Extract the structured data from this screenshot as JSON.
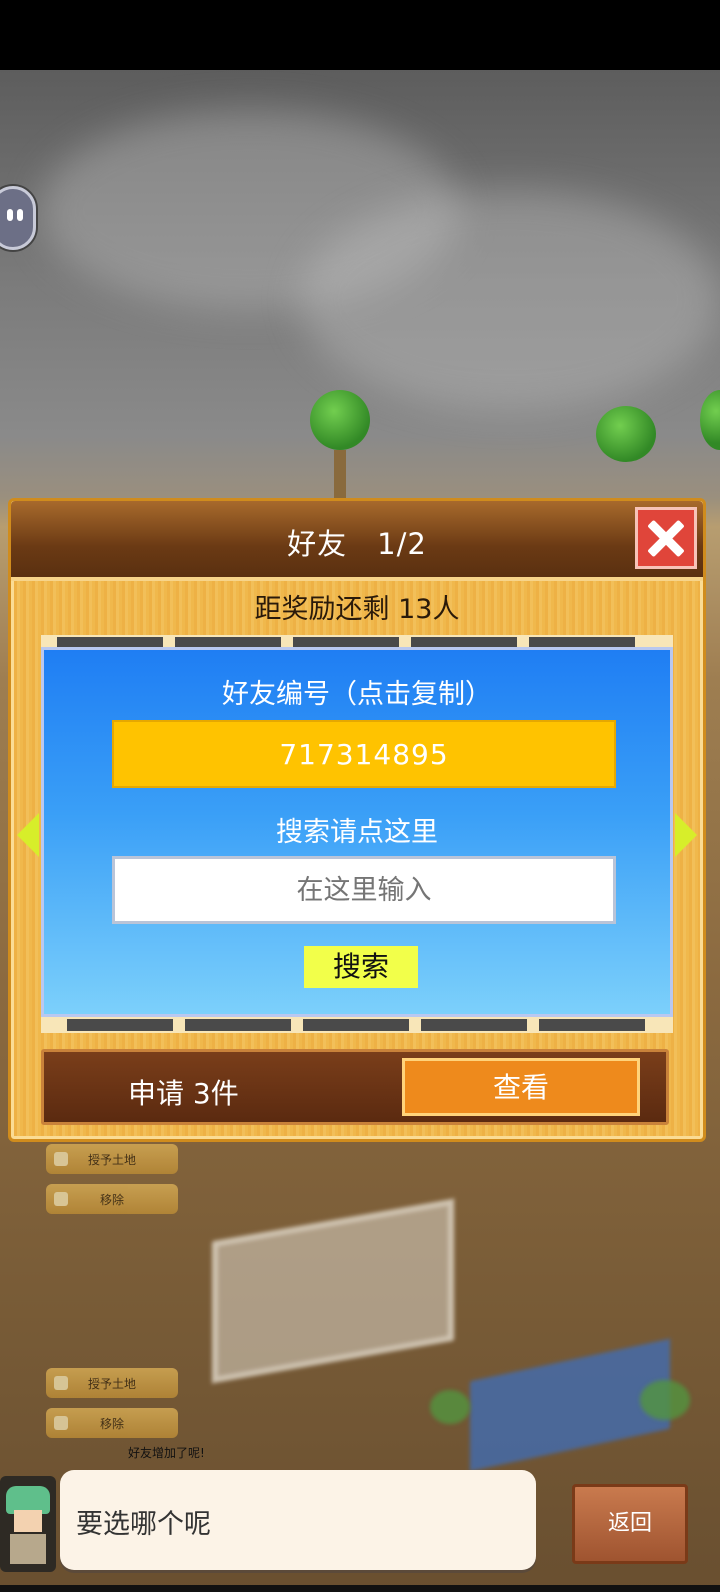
{
  "panel": {
    "title": "好友　1/2",
    "reward_text": "距奖励还剩 13人",
    "friend_id_label": "好友编号（点击复制）",
    "friend_id": "717314895",
    "search_label": "搜索请点这里",
    "search_placeholder": "在这里输入",
    "search_button": "搜索",
    "requests_text": "申请 3件",
    "view_button": "查看"
  },
  "map_buttons": {
    "grant_land_1": "授予土地",
    "remove_1": "移除",
    "grant_land_2": "授予土地",
    "remove_2": "移除"
  },
  "notification": "好友增加了呢!",
  "dialog": {
    "text": "要选哪个呢"
  },
  "back_button": "返回",
  "colors": {
    "panel_wood": "#f0b84c",
    "title_bar": "#6b3a14",
    "close_red": "#e0453a",
    "blue_panel": "#1f7ef3",
    "id_box": "#ffc300",
    "search_button": "#f2ff4a",
    "view_button": "#ee8a1c",
    "arrow": "#d7ee2a"
  },
  "icons": [
    "close-icon",
    "left-arrow-icon",
    "right-arrow-icon",
    "pause-pill-icon"
  ]
}
